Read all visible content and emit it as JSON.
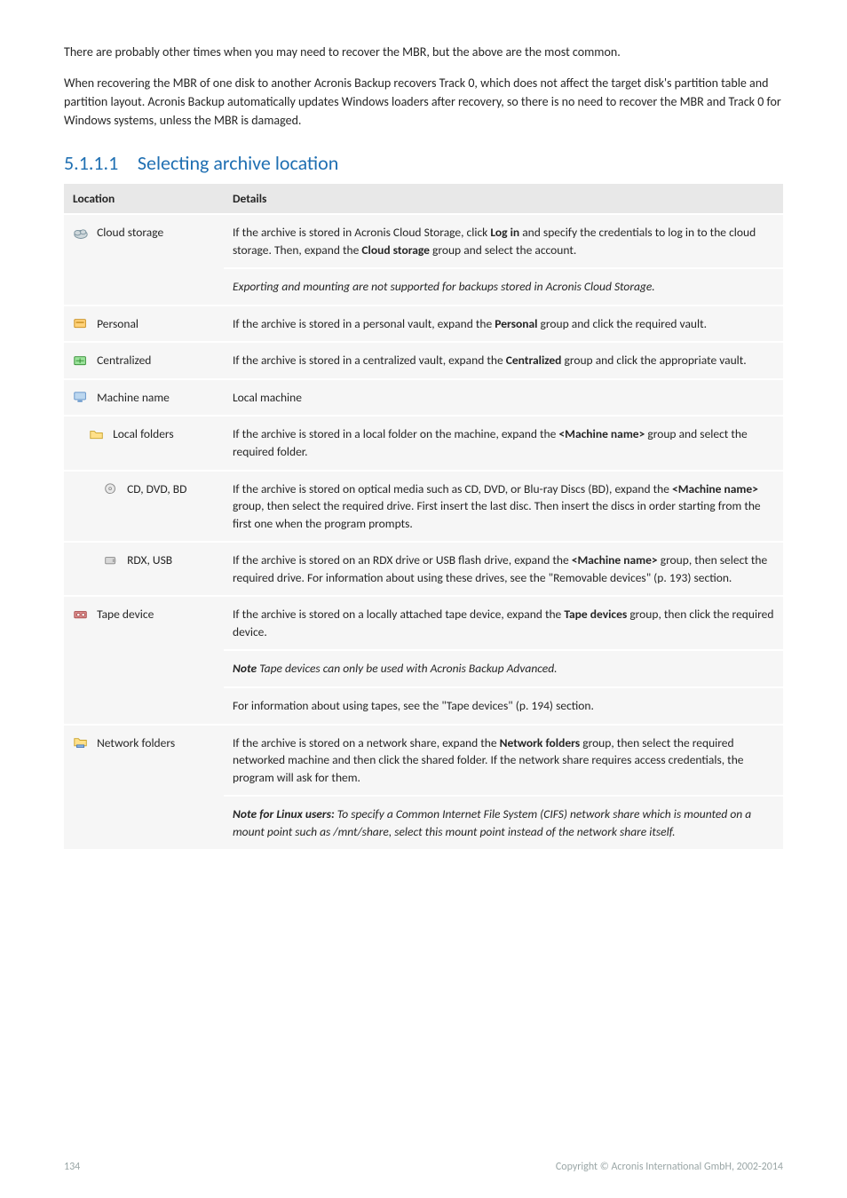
{
  "intro": {
    "p1": "There are probably other times when you may need to recover the MBR, but the above are the most common.",
    "p2": "When recovering the MBR of one disk to another Acronis Backup recovers Track 0, which does not affect the target disk's partition table and partition layout. Acronis Backup automatically updates Windows loaders after recovery, so there is no need to recover the MBR and Track 0 for Windows systems, unless the MBR is damaged."
  },
  "section": {
    "number": "5.1.1.1",
    "title": "Selecting archive location"
  },
  "table": {
    "header_location": "Location",
    "header_details": "Details",
    "cloud_storage": {
      "label": "Cloud storage",
      "d1_pre": "If the archive is stored in Acronis Cloud Storage, click ",
      "d1_b1": "Log in",
      "d1_mid": " and specify the credentials to log in to the cloud storage. Then, expand the ",
      "d1_b2": "Cloud storage",
      "d1_post": " group and select the account.",
      "d2_ital": "Exporting and mounting are not supported for backups stored in Acronis Cloud Storage."
    },
    "personal": {
      "label": "Personal",
      "d_pre": "If the archive is stored in a personal vault, expand the ",
      "d_b": "Personal",
      "d_post": " group and click the required vault."
    },
    "centralized": {
      "label": "Centralized",
      "d_pre": "If the archive is stored in a centralized vault, expand the ",
      "d_b": "Centralized",
      "d_post": " group and click the appropriate vault."
    },
    "machine_name": {
      "label": "Machine name",
      "d": "Local machine"
    },
    "local_folders": {
      "label": "Local folders",
      "d_pre": "If the archive is stored in a local folder on the machine, expand the ",
      "d_b": "<Machine name>",
      "d_post": " group and select the required folder."
    },
    "cd_dvd_bd": {
      "label": "CD, DVD, BD",
      "d_pre": "If the archive is stored on optical media such as CD, DVD, or Blu-ray Discs (BD), expand the ",
      "d_b": "<Machine name>",
      "d_post": " group, then select the required drive. First insert the last disc. Then insert the discs in order starting from the first one when the program prompts."
    },
    "rdx_usb": {
      "label": "RDX, USB",
      "d_pre": "If the archive is stored on an RDX drive or USB flash drive, expand the ",
      "d_b": "<Machine name>",
      "d_post": " group, then select the required drive. For information about using these drives, see the \"Removable devices\" (p. 193) section."
    },
    "tape_device": {
      "label": "Tape device",
      "d1_pre": "If the archive is stored on a locally attached tape device, expand the ",
      "d1_b": "Tape devices",
      "d1_post": " group, then click the required device.",
      "d2_lead_b_i": "Note",
      "d2_rest_i": "  Tape devices can only be used with Acronis Backup Advanced.",
      "d3": "For information about using tapes, see the \"Tape devices\" (p. 194) section."
    },
    "network_folders": {
      "label": "Network folders",
      "d1_pre": "If the archive is stored on a network share, expand the ",
      "d1_b": "Network folders",
      "d1_post": " group, then select the required networked machine and then click the shared folder. If the network share requires access credentials, the program will ask for them.",
      "d2_lead_b_i": "Note for Linux users:",
      "d2_rest_i": " To specify a Common Internet File System (CIFS) network share which is mounted on a mount point such as /mnt/share, select this mount point instead of the network share itself."
    }
  },
  "footer": {
    "page": "134",
    "copyright": "Copyright © Acronis International GmbH, 2002-2014"
  }
}
